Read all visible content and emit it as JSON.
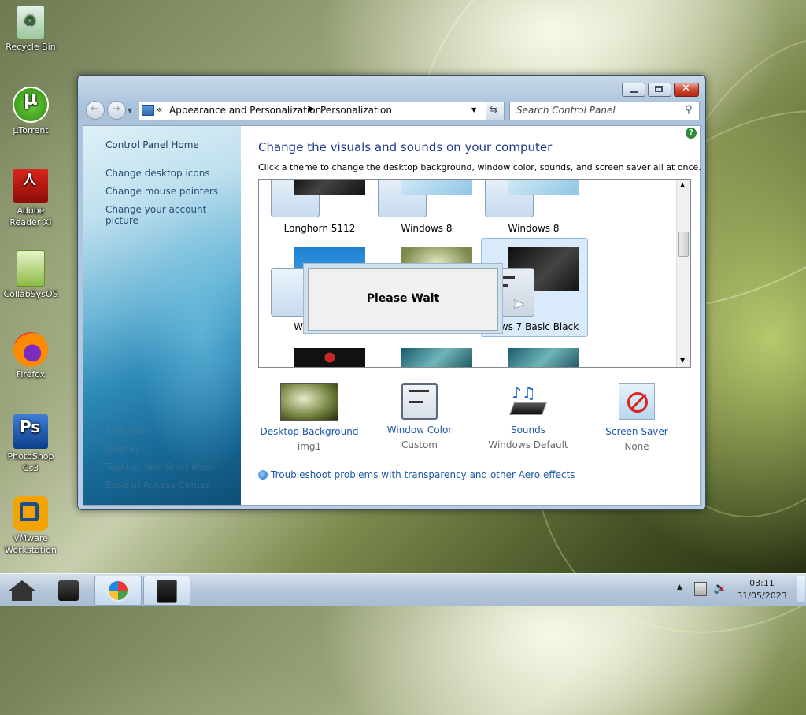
{
  "desktop": {
    "icons": [
      {
        "label": "Recycle Bin",
        "icon": "recycle-bin-icon"
      },
      {
        "label": "µTorrent",
        "icon": "utorrent-icon"
      },
      {
        "label": "Adobe Reader XI",
        "icon": "adobe-reader-icon"
      },
      {
        "label": "CollabSysOS",
        "icon": "folder-icon"
      },
      {
        "label": "Firefox",
        "icon": "firefox-icon"
      },
      {
        "label": "PhotoShop Cs3",
        "icon": "photoshop-icon"
      },
      {
        "label": "VMware Workstation",
        "icon": "vmware-icon"
      }
    ]
  },
  "window": {
    "address": {
      "root": "Appearance and Personalization",
      "current": "Personalization"
    },
    "search_placeholder": "Search Control Panel",
    "sidebar": {
      "home": "Control Panel Home",
      "links": [
        "Change desktop icons",
        "Change mouse pointers",
        "Change your account picture"
      ],
      "see_also_heading": "See also",
      "see_also": [
        "Display",
        "Taskbar and Start Menu",
        "Ease of Access Center"
      ]
    },
    "heading": "Change the visuals and sounds on your computer",
    "subheading": "Click a theme to change the desktop background, window color, sounds, and screen saver all at once.",
    "themes": [
      "Longhorn 5112",
      "Windows 8",
      "Windows 8",
      "W",
      "",
      "dows 7 Basic Black"
    ],
    "dialog": {
      "text": "Please Wait"
    },
    "bottom": [
      {
        "label": "Desktop Background",
        "value": "img1",
        "icon": "desktop-background-icon"
      },
      {
        "label": "Window Color",
        "value": "Custom",
        "icon": "window-color-icon"
      },
      {
        "label": "Sounds",
        "value": "Windows Default",
        "icon": "sounds-icon"
      },
      {
        "label": "Screen Saver",
        "value": "None",
        "icon": "screen-saver-icon"
      }
    ],
    "troubleshoot": "Troubleshoot problems with transparency and other Aero effects"
  },
  "taskbar": {
    "time": "03:11",
    "date": "31/05/2023"
  }
}
